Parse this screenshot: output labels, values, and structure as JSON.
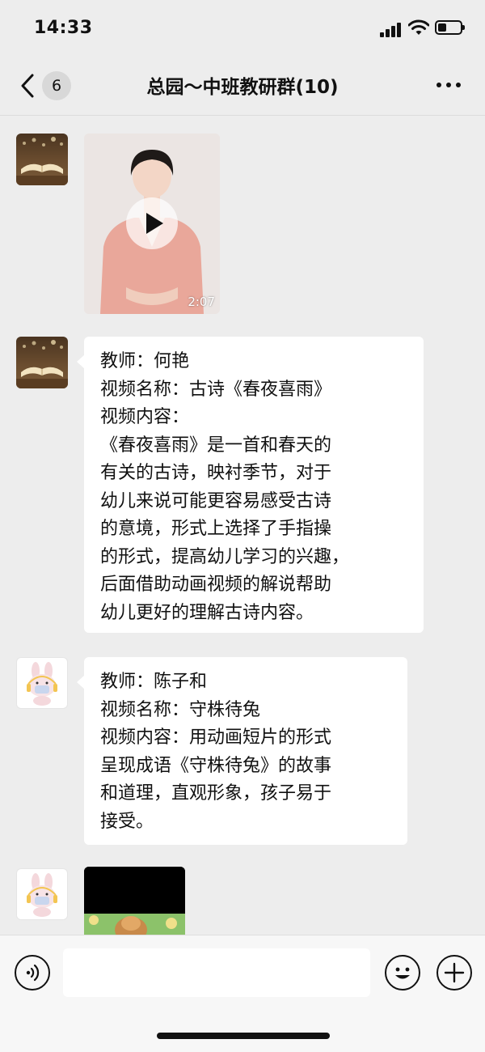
{
  "status_bar": {
    "time": "14:33",
    "icons": [
      "cellular-signal-icon",
      "wifi-icon",
      "battery-icon"
    ]
  },
  "nav": {
    "back_icon": "chevron-left-icon",
    "unread_count": "6",
    "title": "总园～中班教研群(10)",
    "more_icon": "more-dots-icon"
  },
  "messages": [
    {
      "type": "video",
      "avatar": "open-book-avatar",
      "duration": "2:07"
    },
    {
      "type": "text",
      "avatar": "open-book-avatar",
      "lines": [
        "教师：何艳",
        "视频名称：古诗《春夜喜雨》",
        "视频内容：",
        "《春夜喜雨》是一首和春天的",
        "有关的古诗，映衬季节，对于",
        "幼儿来说可能更容易感受古诗",
        "的意境，形式上选择了手指操",
        "的形式，提高幼儿学习的兴趣，",
        "后面借助动画视频的解说帮助",
        "幼儿更好的理解古诗内容。"
      ]
    },
    {
      "type": "text",
      "avatar": "rabbit-avatar",
      "lines": [
        "教师：陈子和",
        "视频名称：守株待兔",
        "视频内容：用动画短片的形式",
        "呈现成语《守株待兔》的故事",
        "和道理，直观形象，孩子易于",
        "接受。"
      ]
    },
    {
      "type": "video",
      "avatar": "rabbit-avatar"
    }
  ],
  "input_bar": {
    "placeholder": "",
    "icons": [
      "voice-icon",
      "emoji-icon",
      "plus-icon"
    ]
  },
  "colors": {
    "background": "#ededed",
    "bubble": "#ffffff",
    "text": "#111111"
  }
}
